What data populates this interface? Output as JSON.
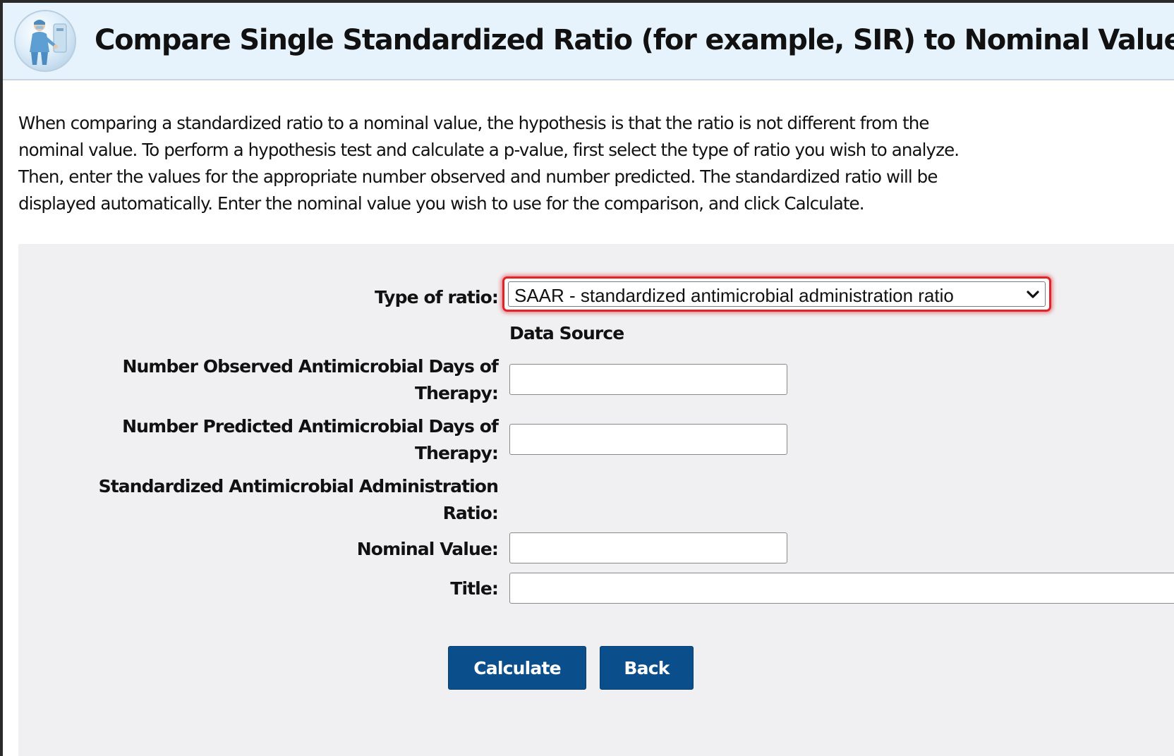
{
  "header": {
    "title": "Compare Single Standardized Ratio (for example, SIR) to Nominal Value",
    "icon": "healthcare-worker-icon"
  },
  "intro": {
    "lines": [
      "When comparing a standardized ratio to a nominal value, the hypothesis is that the ratio is not different from the",
      "nominal value. To perform a hypothesis test and calculate a p-value, first select the type of ratio you wish to analyze.",
      "Then, enter the values for the appropriate number observed and number predicted. The standardized ratio will be",
      "displayed automatically. Enter the nominal value you wish to use for the comparison, and click Calculate."
    ]
  },
  "form": {
    "type_of_ratio_label": "Type of ratio:",
    "type_of_ratio_value": "SAAR - standardized antimicrobial administration ratio",
    "data_source_label": "Data Source",
    "observed_label_line1": "Number Observed Antimicrobial Days of",
    "observed_label_line2": "Therapy:",
    "observed_value": "",
    "predicted_label_line1": "Number Predicted Antimicrobial Days of",
    "predicted_label_line2": "Therapy:",
    "predicted_value": "",
    "ratio_label_line1": "Standardized Antimicrobial Administration",
    "ratio_label_line2": "Ratio:",
    "nominal_label": "Nominal Value:",
    "nominal_value": "",
    "title_label": "Title:",
    "title_value": ""
  },
  "buttons": {
    "calculate": "Calculate",
    "back": "Back"
  },
  "colors": {
    "header_bg": "#e6f2fc",
    "panel_bg": "#f0f0f2",
    "button_bg": "#0a4e8c",
    "highlight": "#e0242a"
  }
}
